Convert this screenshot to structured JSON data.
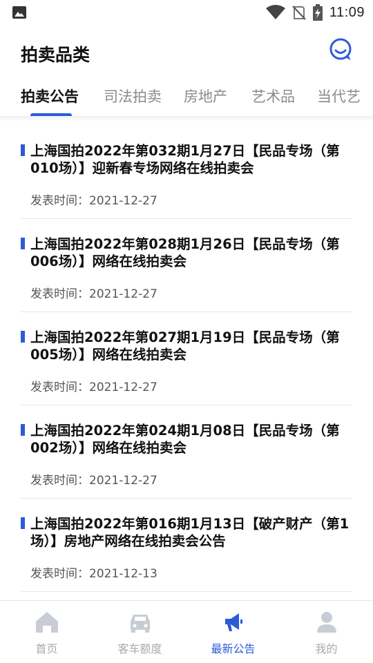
{
  "status_bar": {
    "time": "11:09"
  },
  "header": {
    "title": "拍卖品类"
  },
  "tabs": [
    {
      "label": "拍卖公告"
    },
    {
      "label": "司法拍卖"
    },
    {
      "label": "房地产"
    },
    {
      "label": "艺术品"
    },
    {
      "label": "当代艺"
    }
  ],
  "list": [
    {
      "title": "上海国拍2022年第032期1月27日【民品专场（第010场）】迎新春专场网络在线拍卖会",
      "date_label": "发表时间：",
      "date": "2021-12-27"
    },
    {
      "title": "上海国拍2022年第028期1月26日【民品专场（第006场）】网络在线拍卖会",
      "date_label": "发表时间：",
      "date": "2021-12-27"
    },
    {
      "title": "上海国拍2022年第027期1月19日【民品专场（第005场）】网络在线拍卖会",
      "date_label": "发表时间：",
      "date": "2021-12-27"
    },
    {
      "title": "上海国拍2022年第024期1月08日【民品专场（第002场）】网络在线拍卖会",
      "date_label": "发表时间：",
      "date": "2021-12-27"
    },
    {
      "title": "上海国拍2022年第016期1月13日【破产财产（第1场）】房地产网络在线拍卖会公告",
      "date_label": "发表时间：",
      "date": "2021-12-13"
    }
  ],
  "bottom_nav": [
    {
      "label": "首页",
      "icon": "home-icon"
    },
    {
      "label": "客车额度",
      "icon": "car-icon"
    },
    {
      "label": "最新公告",
      "icon": "megaphone-icon",
      "active": true
    },
    {
      "label": "我的",
      "icon": "user-icon"
    }
  ],
  "colors": {
    "accent": "#2c5bd8",
    "inactive": "#a9a9a9"
  }
}
